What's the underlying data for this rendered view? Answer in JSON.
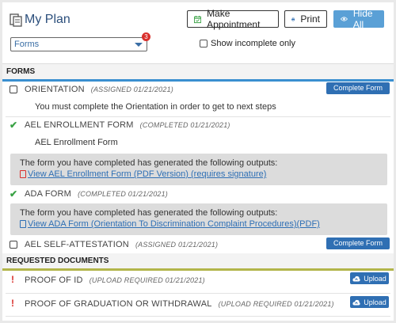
{
  "header": {
    "title": "My Plan",
    "appointment_label": "Make Appointment",
    "print_label": "Print",
    "hide_label": "Hide All",
    "filter_value": "Forms",
    "filter_badge": "3",
    "incomplete_label": "Show incomplete only"
  },
  "forms_section": {
    "heading": "FORMS",
    "orientation": {
      "title": "ORIENTATION",
      "status": "(ASSIGNED 01/21/2021)",
      "button": "Complete Form",
      "note": "You must complete the Orientation in order to get to next steps"
    },
    "enrollment": {
      "title": "AEL ENROLLMENT FORM",
      "status": "(COMPLETED 01/21/2021)",
      "note": "AEL Enrollment Form",
      "outputs_text": "The form you have completed has generated the following outputs:",
      "link": "View AEL Enrollment Form (PDF Version) (requires signature)"
    },
    "ada": {
      "title": "ADA FORM",
      "status": "(COMPLETED 01/21/2021)",
      "outputs_text": "The form you have completed has generated the following outputs:",
      "link": "View ADA Form (Orientation To Discrimination Complaint Procedures)(PDF)"
    },
    "attestation": {
      "title": "AEL SELF-ATTESTATION",
      "status": "(ASSIGNED 01/21/2021)",
      "button": "Complete Form"
    }
  },
  "documents_section": {
    "heading": "REQUESTED DOCUMENTS",
    "items": [
      {
        "title": "PROOF OF ID",
        "status": "(UPLOAD REQUIRED 01/21/2021)",
        "button": "Upload"
      },
      {
        "title": "PROOF OF GRADUATION OR WITHDRAWAL",
        "status": "(UPLOAD REQUIRED 01/21/2021)",
        "button": "Upload"
      }
    ]
  },
  "colors": {
    "accent_blue": "#2f6fb3",
    "hide_button": "#5aa0d6",
    "forms_bar": "#3a8fd0",
    "documents_bar": "#b2b54a",
    "complete_check": "#3aa245",
    "required_mark": "#d9302c"
  },
  "icons": [
    "clipboard-icon",
    "calendar-icon",
    "printer-icon",
    "eye-icon",
    "check-icon",
    "exclamation-icon",
    "pdf-icon",
    "document-icon",
    "cloud-upload-icon"
  ]
}
